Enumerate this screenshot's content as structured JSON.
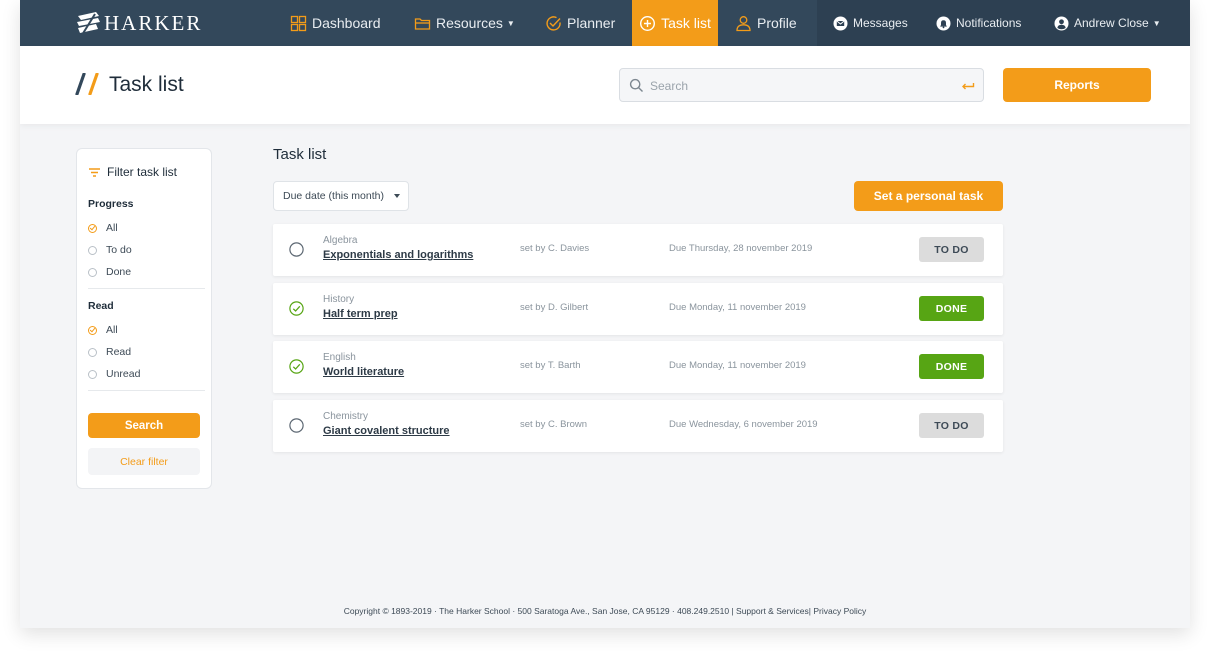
{
  "brand": {
    "name": "HARKER"
  },
  "nav": {
    "items": [
      {
        "label": "Dashboard",
        "icon": "dashboard-icon",
        "active": false
      },
      {
        "label": "Resources",
        "icon": "folder-icon",
        "active": false,
        "has_caret": true
      },
      {
        "label": "Planner",
        "icon": "check-circle-icon",
        "active": false
      },
      {
        "label": "Task list",
        "icon": "plus-circle-icon",
        "active": true
      },
      {
        "label": "Profile",
        "icon": "user-icon",
        "active": false
      }
    ],
    "messages": "Messages",
    "notifications": "Notifications",
    "user": "Andrew Close"
  },
  "header": {
    "title": "Task list",
    "search_placeholder": "Search",
    "reports_label": "Reports"
  },
  "filter": {
    "title": "Filter task list",
    "progress": {
      "title": "Progress",
      "options": [
        "All",
        "To do",
        "Done"
      ],
      "selected": "All"
    },
    "read": {
      "title": "Read",
      "options": [
        "All",
        "Read",
        "Unread"
      ],
      "selected": "All"
    },
    "search_label": "Search",
    "clear_label": "Clear filter"
  },
  "main": {
    "title": "Task list",
    "due_select": "Due date (this month)",
    "personal_task_label": "Set a personal task",
    "tasks": [
      {
        "subject": "Algebra",
        "name": "Exponentials and logarithms",
        "set_by": "set by C. Davies",
        "due": "Due Thursday, 28 november 2019",
        "status": "TO DO",
        "done": false
      },
      {
        "subject": "History",
        "name": "Half term prep",
        "set_by": "set by D. Gilbert",
        "due": "Due Monday, 11 november 2019",
        "status": "DONE",
        "done": true
      },
      {
        "subject": "English",
        "name": "World literature",
        "set_by": "set by T. Barth",
        "due": "Due Monday, 11 november 2019",
        "status": "DONE",
        "done": true
      },
      {
        "subject": "Chemistry",
        "name": "Giant covalent structure",
        "set_by": "set by C. Brown",
        "due": "Due Wednesday, 6 november 2019",
        "status": "TO DO",
        "done": false
      }
    ]
  },
  "footer": {
    "copyright": "Copyright © 1893-2019 · The Harker School · 500 Saratoga Ave., San Jose, CA 95129 · 408.249.2510 | ",
    "support": "Support & Services",
    "separator": "| ",
    "privacy": "Privacy Policy"
  },
  "colors": {
    "accent": "#f39c19",
    "nav_bg": "#33485b",
    "done": "#57a514",
    "todo": "#dcdcdc"
  }
}
